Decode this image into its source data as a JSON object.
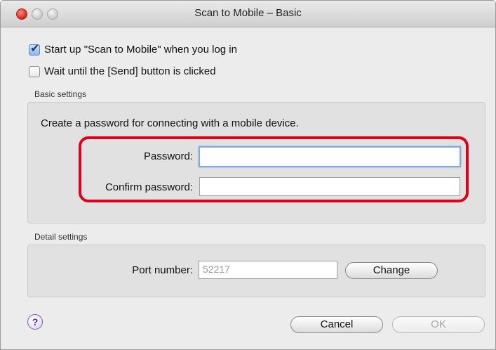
{
  "window": {
    "title": "Scan to Mobile – Basic"
  },
  "options": {
    "startup_label": "Start up \"Scan to Mobile\" when you log in",
    "startup_checked": true,
    "wait_label": "Wait until the [Send] button is clicked",
    "wait_checked": false
  },
  "basic": {
    "group_label": "Basic settings",
    "description": "Create a password for connecting with a mobile device.",
    "password_label": "Password:",
    "password_value": "",
    "confirm_label": "Confirm password:",
    "confirm_value": ""
  },
  "detail": {
    "group_label": "Detail settings",
    "port_label": "Port number:",
    "port_value": "52217",
    "change_label": "Change"
  },
  "footer": {
    "help_glyph": "?",
    "cancel_label": "Cancel",
    "ok_label": "OK"
  },
  "colors": {
    "highlight": "#e0001b",
    "focus_ring": "#7fa9df",
    "help": "#5a2f98"
  }
}
